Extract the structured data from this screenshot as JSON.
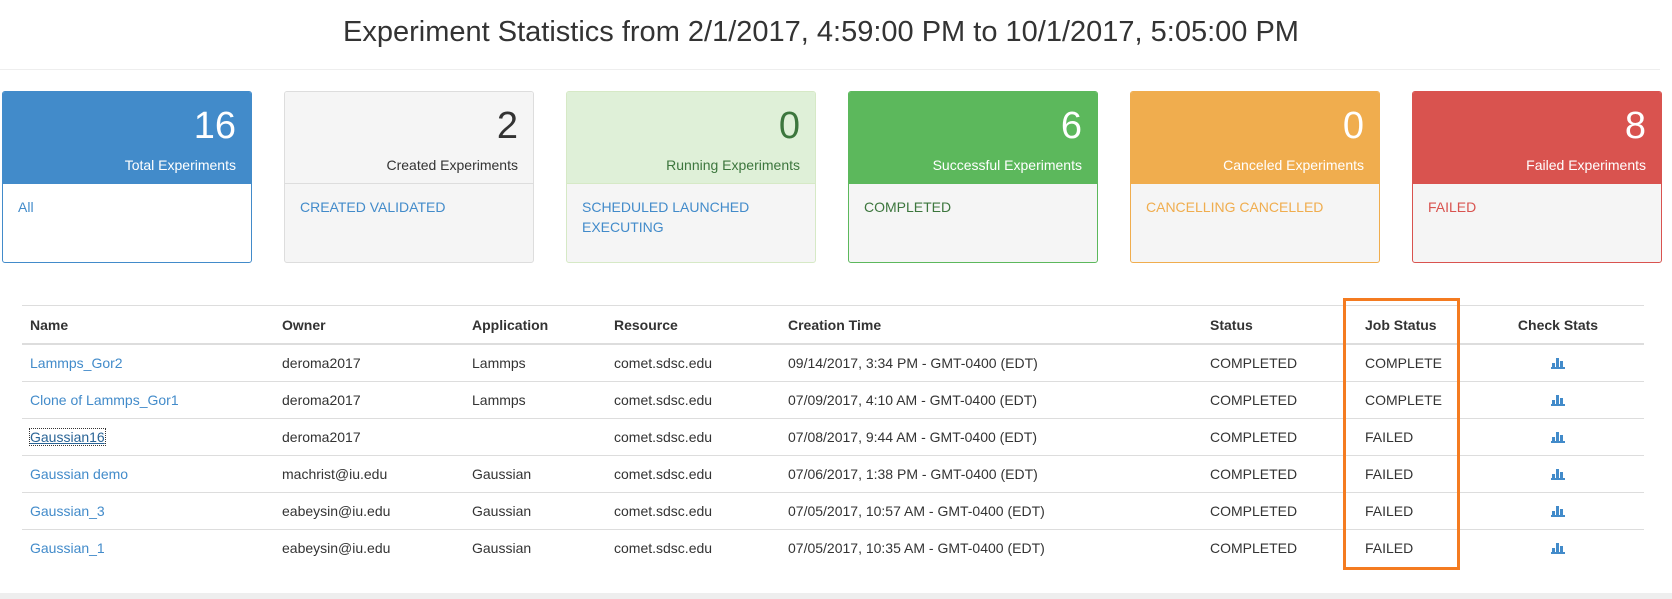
{
  "page": {
    "title": "Experiment Statistics from 2/1/2017, 4:59:00 PM to 10/1/2017, 5:05:00 PM"
  },
  "cards": {
    "total": {
      "count": "16",
      "label": "Total Experiments",
      "states": "All"
    },
    "created": {
      "count": "2",
      "label": "Created Experiments",
      "states": "CREATED VALIDATED"
    },
    "running": {
      "count": "0",
      "label": "Running Experiments",
      "states": "SCHEDULED LAUNCHED EXECUTING"
    },
    "success": {
      "count": "6",
      "label": "Successful Experiments",
      "states": "COMPLETED"
    },
    "cancel": {
      "count": "0",
      "label": "Canceled Experiments",
      "states": "CANCELLING CANCELLED"
    },
    "failed": {
      "count": "8",
      "label": "Failed Experiments",
      "states": "FAILED"
    }
  },
  "table": {
    "headers": {
      "name": "Name",
      "owner": "Owner",
      "application": "Application",
      "resource": "Resource",
      "creation_time": "Creation Time",
      "status": "Status",
      "job_status": "Job Status",
      "check_stats": "Check Stats"
    },
    "rows": [
      {
        "name": "Lammps_Gor2",
        "owner": "deroma2017",
        "application": "Lammps",
        "resource": "comet.sdsc.edu",
        "creation_time": "09/14/2017, 3:34 PM - GMT-0400 (EDT)",
        "status": "COMPLETED",
        "job_status": "COMPLETE"
      },
      {
        "name": "Clone of Lammps_Gor1",
        "owner": "deroma2017",
        "application": "Lammps",
        "resource": "comet.sdsc.edu",
        "creation_time": "07/09/2017, 4:10 AM - GMT-0400 (EDT)",
        "status": "COMPLETED",
        "job_status": "COMPLETE"
      },
      {
        "name": "Gaussian16",
        "owner": "deroma2017",
        "application": "",
        "resource": "comet.sdsc.edu",
        "creation_time": "07/08/2017, 9:44 AM - GMT-0400 (EDT)",
        "status": "COMPLETED",
        "job_status": "FAILED"
      },
      {
        "name": "Gaussian demo",
        "owner": "machrist@iu.edu",
        "application": "Gaussian",
        "resource": "comet.sdsc.edu",
        "creation_time": "07/06/2017, 1:38 PM - GMT-0400 (EDT)",
        "status": "COMPLETED",
        "job_status": "FAILED"
      },
      {
        "name": "Gaussian_3",
        "owner": "eabeysin@iu.edu",
        "application": "Gaussian",
        "resource": "comet.sdsc.edu",
        "creation_time": "07/05/2017, 10:57 AM - GMT-0400 (EDT)",
        "status": "COMPLETED",
        "job_status": "FAILED"
      },
      {
        "name": "Gaussian_1",
        "owner": "eabeysin@iu.edu",
        "application": "Gaussian",
        "resource": "comet.sdsc.edu",
        "creation_time": "07/05/2017, 10:35 AM - GMT-0400 (EDT)",
        "status": "COMPLETED",
        "job_status": "FAILED"
      }
    ],
    "check_stats_icon": "bar-chart-icon"
  },
  "colors": {
    "primary": "#428bca",
    "success": "#5cb85c",
    "success_text": "#3c763d",
    "warning": "#f0ad4e",
    "danger": "#d9534f",
    "highlight": "#f47b20"
  }
}
